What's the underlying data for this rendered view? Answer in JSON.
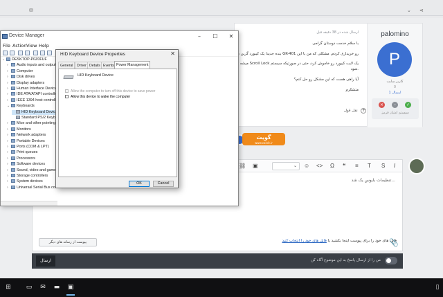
{
  "forum": {
    "post": {
      "username": "palomino",
      "avatar_letter": "P",
      "role": "کاربر سایت",
      "zero": "0",
      "posts_count": "1 ارسال",
      "rep_label": "سیستم امتیاز قرمز",
      "date": "ارسال شده در 38 دقیقه قبل",
      "lines": [
        "با سلام خدمت دوستان گرامی",
        "بنده جدیدا یک کیبورد گرین مدل GK-401 رو خریداری کردم، مشکلی که من با این",
        "میشه با زدن دکمه Scroll Lock یک لایت کیبورد رو خاموش کرد، حتی در صورتیکه سیستم",
        "شود.",
        "آیا راهی هست که این مشکل رو حل کنم؟",
        "متشکرم"
      ],
      "quote_label": "نقل قول"
    },
    "watermark": {
      "text": "گویت",
      "url": "www.coinit.ir"
    },
    "editor": {
      "placeholder": "تنظیمات بایوس یک شد...",
      "attach_text": "فایل های خود را برای پیوست اینجا بکشید یا",
      "attach_link": "فایل های خود را انتخاب کنید",
      "insert_button": "پیوست از رسانه های دیگر",
      "submit": "ارسال",
      "notify_label": "من را از ارسال پاسخ به این موضوع آگاه کن"
    }
  },
  "device_manager": {
    "title": "Device Manager",
    "menu": [
      "File",
      "Action",
      "View",
      "Help"
    ],
    "tree": [
      {
        "label": "DESKTOP-P0Z0FUF",
        "level": 0,
        "expander": "⌄"
      },
      {
        "label": "Audio inputs and output",
        "level": 1,
        "expander": "›"
      },
      {
        "label": "Computer",
        "level": 1,
        "expander": "›"
      },
      {
        "label": "Disk drives",
        "level": 1,
        "expander": "›"
      },
      {
        "label": "Display adapters",
        "level": 1,
        "expander": "›"
      },
      {
        "label": "Human Interface Device",
        "level": 1,
        "expander": "›"
      },
      {
        "label": "IDE ATA/ATAPI controlle",
        "level": 1,
        "expander": "›"
      },
      {
        "label": "IEEE 1394 host controlle",
        "level": 1,
        "expander": "›"
      },
      {
        "label": "Keyboards",
        "level": 1,
        "expander": "⌄"
      },
      {
        "label": "HID Keyboard Device",
        "level": 2,
        "expander": ""
      },
      {
        "label": "Standard PS/2 Keyboard",
        "level": 2,
        "expander": ""
      },
      {
        "label": "Mice and other pointing",
        "level": 1,
        "expander": "›"
      },
      {
        "label": "Monitors",
        "level": 1,
        "expander": "›"
      },
      {
        "label": "Network adapters",
        "level": 1,
        "expander": "›"
      },
      {
        "label": "Portable Devices",
        "level": 1,
        "expander": "›"
      },
      {
        "label": "Ports (COM & LPT)",
        "level": 1,
        "expander": "›"
      },
      {
        "label": "Print queues",
        "level": 1,
        "expander": "›"
      },
      {
        "label": "Processors",
        "level": 1,
        "expander": "›"
      },
      {
        "label": "Software devices",
        "level": 1,
        "expander": "›"
      },
      {
        "label": "Sound, video and game",
        "level": 1,
        "expander": "›"
      },
      {
        "label": "Storage controllers",
        "level": 1,
        "expander": "›"
      },
      {
        "label": "System devices",
        "level": 1,
        "expander": "›"
      },
      {
        "label": "Universal Serial Bus cont",
        "level": 1,
        "expander": "›"
      }
    ]
  },
  "dialog": {
    "title": "HID Keyboard Device Properties",
    "tabs": [
      "General",
      "Driver",
      "Details",
      "Events",
      "Power Management"
    ],
    "active_tab": "Power Management",
    "device_name": "HID Keyboard Device",
    "option_power_off": "Allow the computer to turn off this device to save power",
    "option_wake": "Allow this device to wake the computer",
    "ok": "OK",
    "cancel": "Cancel"
  },
  "colors": {
    "accent": "#3b6fd1",
    "watermark": "#f08a1a",
    "taskbar": "#101012",
    "submit_bar": "#3a3f46"
  }
}
